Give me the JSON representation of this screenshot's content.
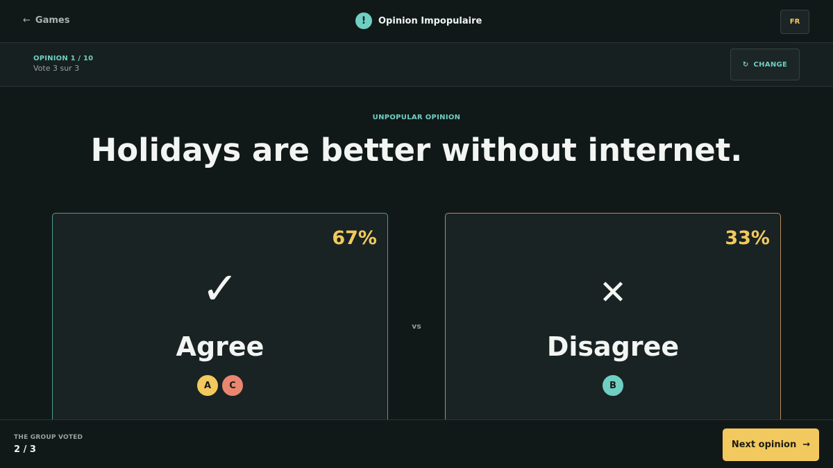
{
  "header": {
    "back_label": "Games",
    "back_arrow": "←",
    "logo_glyph": "!",
    "app_name": "Opinion Impopulaire",
    "language": "FR"
  },
  "round": {
    "counter": "OPINION 1 / 10",
    "vote_status": "Vote 3 sur 3",
    "change_label": "CHANGE",
    "change_icon": "↻"
  },
  "prompt": {
    "kicker": "UNPOPULAR OPINION",
    "statement": "Holidays are better without internet."
  },
  "options": [
    {
      "label": "Agree",
      "percent_text": "67%",
      "percent": 67,
      "icon": "check-icon",
      "glyph": "✓",
      "accent": "#4f9e94",
      "voters": [
        {
          "initial": "A",
          "color": "#f2c95e"
        },
        {
          "initial": "C",
          "color": "#ea8670"
        }
      ]
    },
    {
      "label": "Disagree",
      "percent_text": "33%",
      "percent": 33,
      "icon": "cross-icon",
      "glyph": "✕",
      "accent": "#b98a5e",
      "voters": [
        {
          "initial": "B",
          "color": "#6fcfc2"
        }
      ]
    }
  ],
  "vs_label": "vs",
  "footer": {
    "group_label": "THE GROUP VOTED",
    "group_count": "2 / 3",
    "next_label": "Next opinion",
    "next_arrow": "→"
  },
  "colors": {
    "background": "#111818",
    "accent_teal": "#6fcfc2",
    "accent_yellow": "#f2c95e"
  }
}
